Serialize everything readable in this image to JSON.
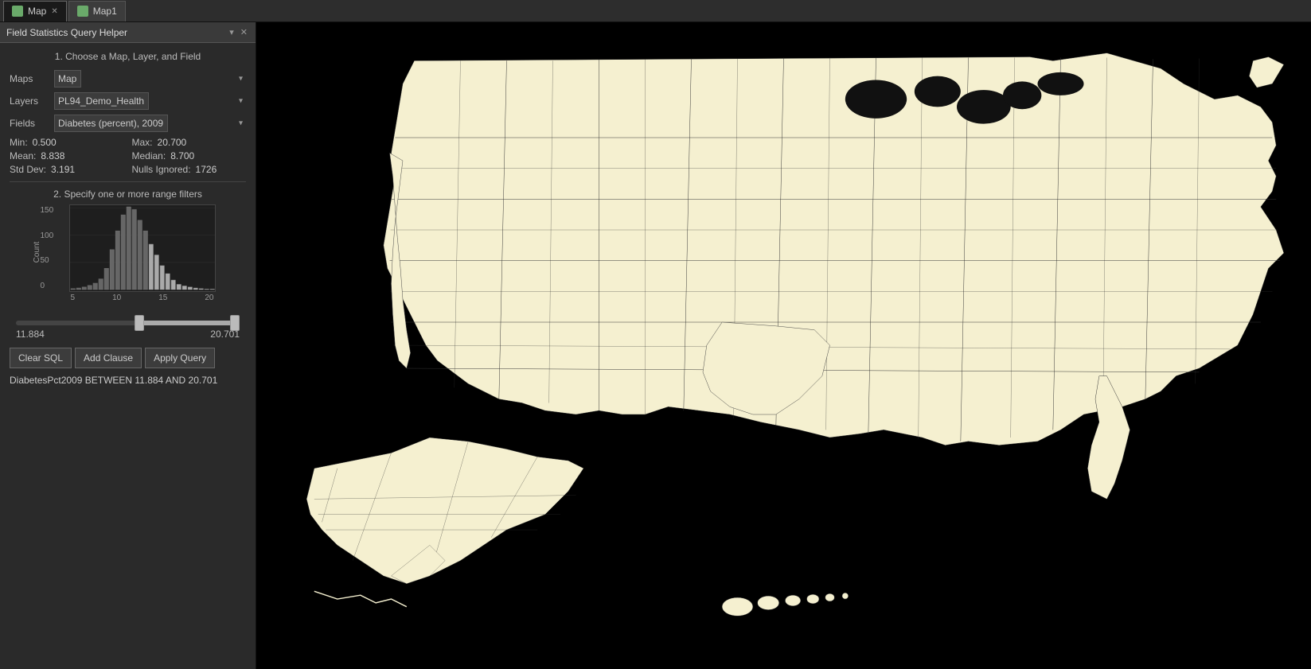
{
  "tabBar": {
    "tabs": [
      {
        "id": "map",
        "label": "Map",
        "icon": "map-icon",
        "active": true,
        "closeable": true
      },
      {
        "id": "map1",
        "label": "Map1",
        "icon": "map-icon",
        "active": false,
        "closeable": false
      }
    ]
  },
  "panel": {
    "title": "Field Statistics Query Helper",
    "step1": "1. Choose a Map, Layer, and Field",
    "step2": "2. Specify one or more range filters",
    "maps_label": "Maps",
    "layers_label": "Layers",
    "fields_label": "Fields",
    "maps_value": "Map",
    "layers_value": "PL94_Demo_Health",
    "fields_value": "Diabetes (percent), 2009",
    "stats": {
      "min_label": "Min:",
      "min_value": "0.500",
      "max_label": "Max:",
      "max_value": "20.700",
      "mean_label": "Mean:",
      "mean_value": "8.838",
      "median_label": "Median:",
      "median_value": "8.700",
      "stddev_label": "Std Dev:",
      "stddev_value": "3.191",
      "nulls_label": "Nulls Ignored:",
      "nulls_value": "1726"
    },
    "histogram": {
      "y_label": "Count",
      "x_ticks": [
        "5",
        "10",
        "15",
        "20"
      ],
      "bars": [
        2,
        3,
        5,
        8,
        12,
        20,
        40,
        75,
        110,
        140,
        155,
        150,
        130,
        110,
        85,
        65,
        45,
        30,
        18,
        10,
        7,
        5,
        3,
        2,
        1,
        1
      ]
    },
    "y_axis_ticks": [
      "0",
      "50",
      "100",
      "150"
    ],
    "range": {
      "low": "11.884",
      "high": "20.701",
      "left_pct": 57,
      "right_pct": 98
    },
    "buttons": {
      "clear_sql": "Clear SQL",
      "add_clause": "Add Clause",
      "apply_query": "Apply Query"
    },
    "sql": "DiabetesPct2009 BETWEEN 11.884 AND 20.701"
  }
}
